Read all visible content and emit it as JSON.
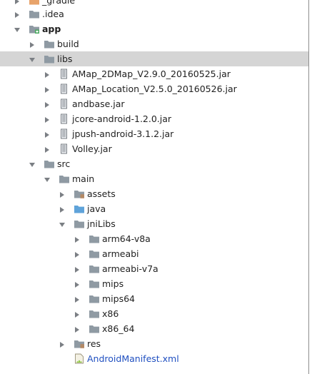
{
  "project_tree": {
    "rows": [
      {
        "label": "_gradle",
        "type": "folder-orange",
        "expandable": true,
        "expanded": false
      },
      {
        "label": ".idea",
        "type": "folder",
        "expandable": true,
        "expanded": false
      },
      {
        "label": "app",
        "type": "module-folder",
        "expandable": true,
        "expanded": true,
        "bold": true
      },
      {
        "label": "build",
        "type": "folder",
        "expandable": true,
        "expanded": false
      },
      {
        "label": "libs",
        "type": "folder",
        "expandable": true,
        "expanded": true,
        "selected": true
      },
      {
        "label": "AMap_2DMap_V2.9.0_20160525.jar",
        "type": "jar",
        "expandable": true,
        "expanded": false
      },
      {
        "label": "AMap_Location_V2.5.0_20160526.jar",
        "type": "jar",
        "expandable": true,
        "expanded": false
      },
      {
        "label": "andbase.jar",
        "type": "jar",
        "expandable": true,
        "expanded": false
      },
      {
        "label": "jcore-android-1.2.0.jar",
        "type": "jar",
        "expandable": true,
        "expanded": false
      },
      {
        "label": "jpush-android-3.1.2.jar",
        "type": "jar",
        "expandable": true,
        "expanded": false
      },
      {
        "label": "Volley.jar",
        "type": "jar",
        "expandable": true,
        "expanded": false
      },
      {
        "label": "src",
        "type": "folder",
        "expandable": true,
        "expanded": true
      },
      {
        "label": "main",
        "type": "folder",
        "expandable": true,
        "expanded": true
      },
      {
        "label": "assets",
        "type": "resource-folder",
        "expandable": true,
        "expanded": false
      },
      {
        "label": "java",
        "type": "source-folder",
        "expandable": true,
        "expanded": false
      },
      {
        "label": "jniLibs",
        "type": "folder",
        "expandable": true,
        "expanded": true
      },
      {
        "label": "arm64-v8a",
        "type": "folder",
        "expandable": true,
        "expanded": false
      },
      {
        "label": "armeabi",
        "type": "folder",
        "expandable": true,
        "expanded": false
      },
      {
        "label": "armeabi-v7a",
        "type": "folder",
        "expandable": true,
        "expanded": false
      },
      {
        "label": "mips",
        "type": "folder",
        "expandable": true,
        "expanded": false
      },
      {
        "label": "mips64",
        "type": "folder",
        "expandable": true,
        "expanded": false
      },
      {
        "label": "x86",
        "type": "folder",
        "expandable": true,
        "expanded": false
      },
      {
        "label": "x86_64",
        "type": "folder",
        "expandable": true,
        "expanded": false
      },
      {
        "label": "res",
        "type": "resource-folder",
        "expandable": true,
        "expanded": false
      },
      {
        "label": "AndroidManifest.xml",
        "type": "manifest",
        "expandable": false,
        "expanded": false,
        "manifest": true
      }
    ]
  },
  "colors": {
    "folder": "#8f9aa3",
    "folder_orange": "#e8a36a",
    "source_folder": "#5fa3d9",
    "jar": "#7a7f86",
    "arrow": "#7b7f84",
    "selection": "#d5d5d5",
    "manifest_text": "#1f4fc0"
  }
}
